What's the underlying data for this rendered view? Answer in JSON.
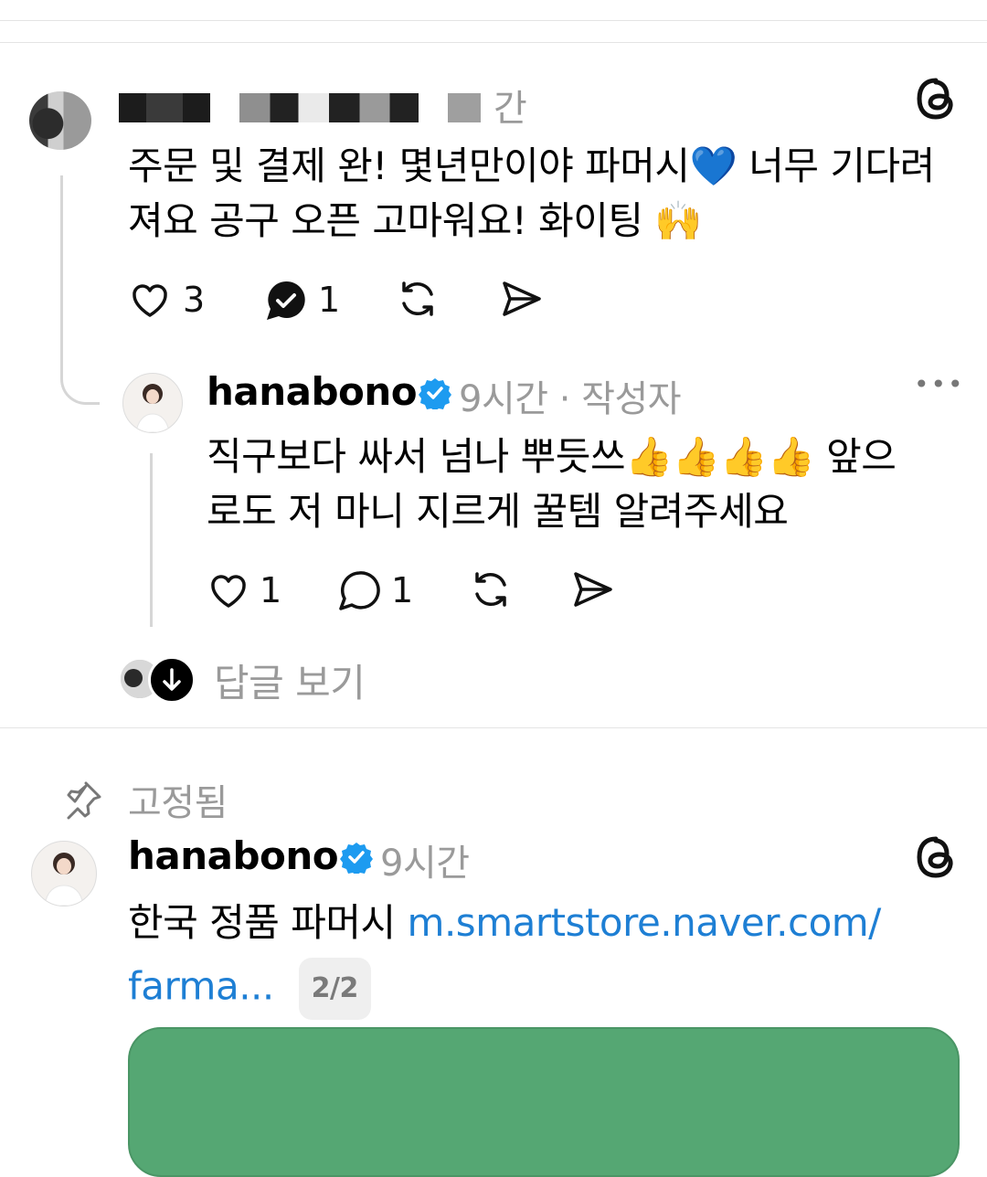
{
  "comment1": {
    "time_partial": "간",
    "text_line1": "주문 및 결제 완! 몇년만이야 파머시💙 너무 기다려",
    "text_line2": "져요 공구 오픈 고마워요! 화이팅 🙌",
    "likes": "3",
    "replies": "1"
  },
  "reply1": {
    "username": "hanabono",
    "meta": "9시간 · 작성자",
    "more_label": "•••",
    "text_line1": "직구보다 싸서 넘나 뿌듯쓰👍👍👍👍 앞으",
    "text_line2": "로도 저 마니 지르게 꿀템 알려주세요",
    "likes": "1",
    "replies": "1"
  },
  "view_replies_label": "답글 보기",
  "pinned": {
    "label": "고정됨",
    "username": "hanabono",
    "time": "9시간",
    "text_prefix": "한국 정품 파머시 ",
    "link_line1": "m.smartstore.naver.com/",
    "link_line2": "farma...",
    "page_indicator": "2/2"
  },
  "colors": {
    "verified": "#1d9bf0",
    "link": "#1e7fd4",
    "media_green": "#55a773"
  }
}
